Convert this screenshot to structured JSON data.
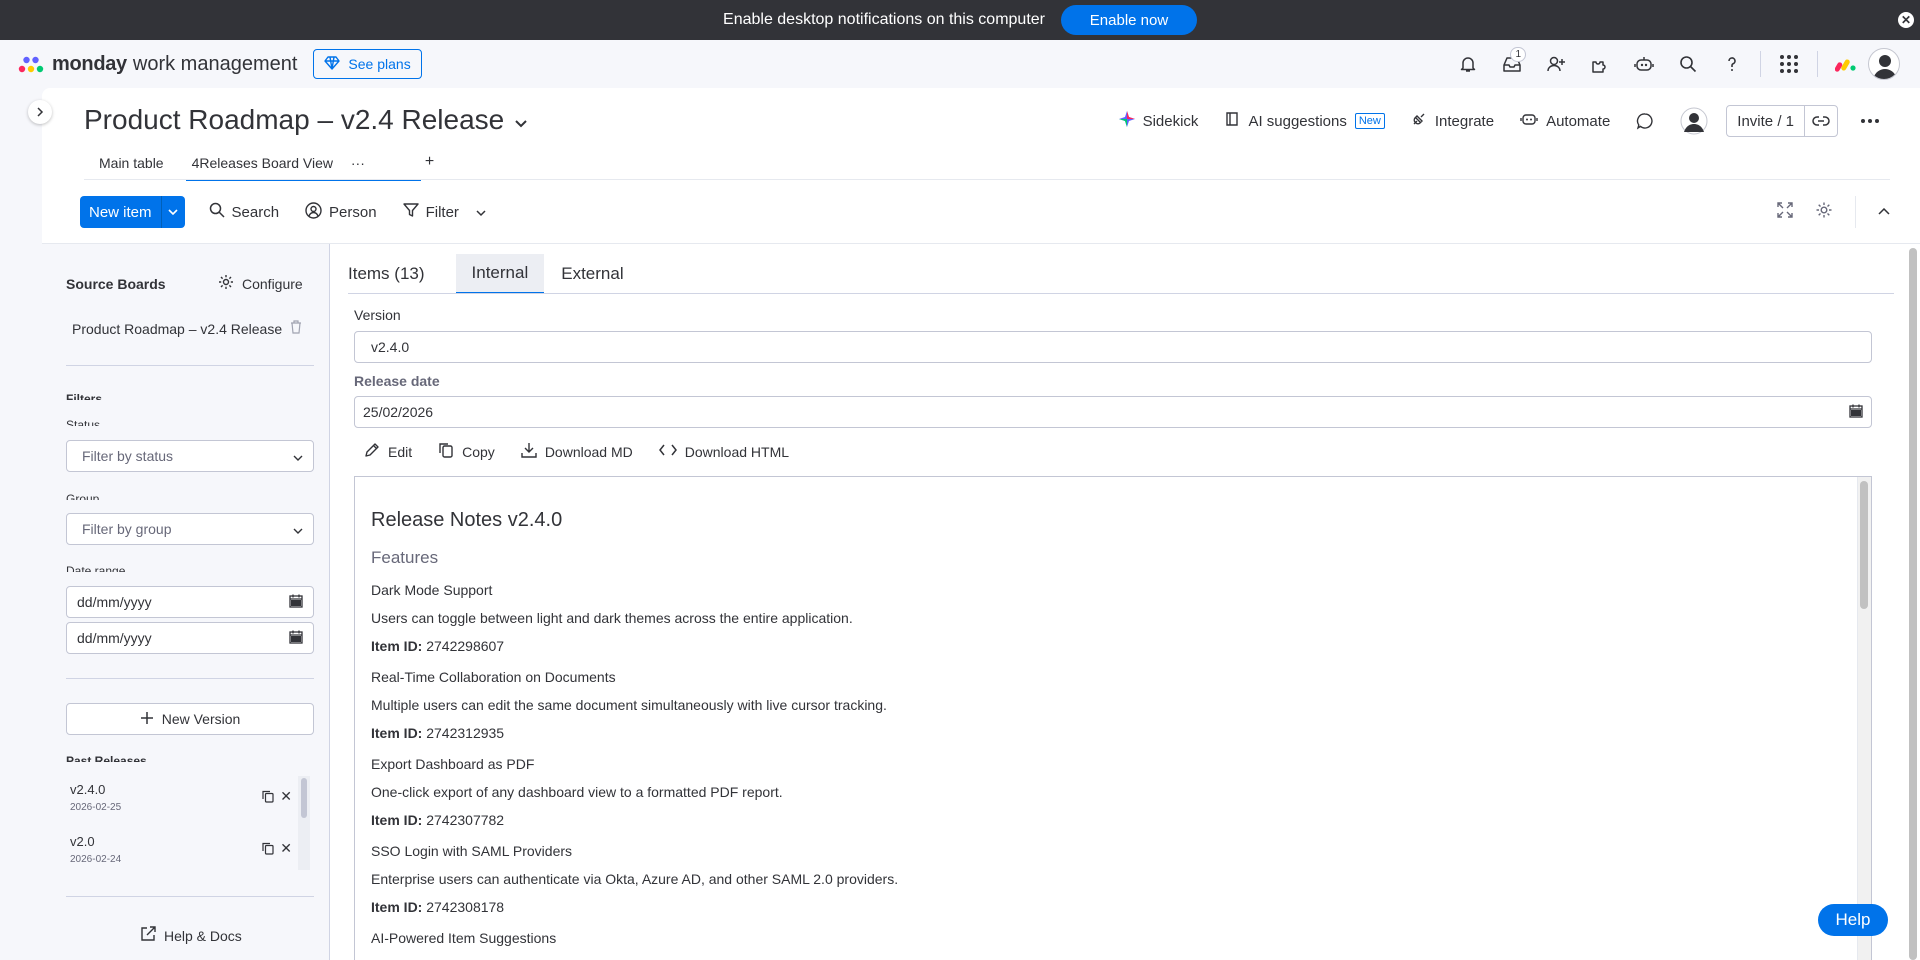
{
  "notification": {
    "text": "Enable desktop notifications on this computer",
    "button": "Enable now",
    "close": "✕"
  },
  "topnav": {
    "brand": "monday",
    "product": "work management",
    "see_plans": "See plans",
    "inbox_count": "1",
    "icons": [
      "bell-icon",
      "inbox-icon",
      "invite-members-icon",
      "apps-icon",
      "ai-assistant-icon",
      "search-icon",
      "help-icon",
      "app-switcher-icon",
      "monday-products-icon",
      "avatar"
    ]
  },
  "board": {
    "title": "Product Roadmap – v2.4 Release",
    "sidekick": "Sidekick",
    "ai_suggestions": "AI suggestions",
    "new_tag": "New",
    "integrate": "Integrate",
    "automate": "Automate",
    "invite": "Invite / 1"
  },
  "views": {
    "main_table": "Main table",
    "active_view": "4Releases Board View",
    "more": "···",
    "add": "+"
  },
  "toolbar": {
    "new_item": "New item",
    "search": "Search",
    "person": "Person",
    "filter": "Filter"
  },
  "left_panel": {
    "source_boards": "Source Boards",
    "configure": "Configure",
    "board_name": "Product Roadmap – v2.4 Release",
    "filters": "Filters",
    "status_label": "Status",
    "status_placeholder": "Filter by status",
    "group_label": "Group",
    "group_placeholder": "Filter by group",
    "date_label": "Date range",
    "date_from": "dd/mm/yyyy",
    "date_to": "dd/mm/yyyy",
    "new_version": "New Version",
    "past_releases": "Past Releases",
    "releases": [
      {
        "version": "v2.4.0",
        "date": "2026-02-25"
      },
      {
        "version": "v2.0",
        "date": "2026-02-24"
      }
    ],
    "help_docs": "Help & Docs"
  },
  "right_panel": {
    "tabs": [
      "Items (13)",
      "Internal",
      "External"
    ],
    "active_tab": "Internal",
    "version_label": "Version",
    "version_value": "v2.4.0",
    "release_date_label": "Release date",
    "release_date_value": "25/02/2026",
    "actions": {
      "edit": "Edit",
      "copy": "Copy",
      "download_md": "Download MD",
      "download_html": "Download HTML"
    },
    "preview": {
      "title": "Release Notes v2.4.0",
      "section": "Features",
      "item_id_label": "Item ID:",
      "items": [
        {
          "name": "Dark Mode Support",
          "description": "Users can toggle between light and dark themes across the entire application.",
          "id": "2742298607"
        },
        {
          "name": "Real-Time Collaboration on Documents",
          "description": "Multiple users can edit the same document simultaneously with live cursor tracking.",
          "id": "2742312935"
        },
        {
          "name": "Export Dashboard as PDF",
          "description": "One-click export of any dashboard view to a formatted PDF report.",
          "id": "2742307782"
        },
        {
          "name": "SSO Login with SAML Providers",
          "description": "Enterprise users can authenticate via Okta, Azure AD, and other SAML 2.0 providers.",
          "id": "2742308178"
        },
        {
          "name": "AI-Powered Item Suggestions",
          "description": "",
          "id": ""
        }
      ]
    }
  },
  "help_button": "Help",
  "colors": {
    "primary": "#0073ea",
    "dark_bar": "#323338",
    "surface": "#f6f7fb",
    "border": "#c3c6d4"
  }
}
